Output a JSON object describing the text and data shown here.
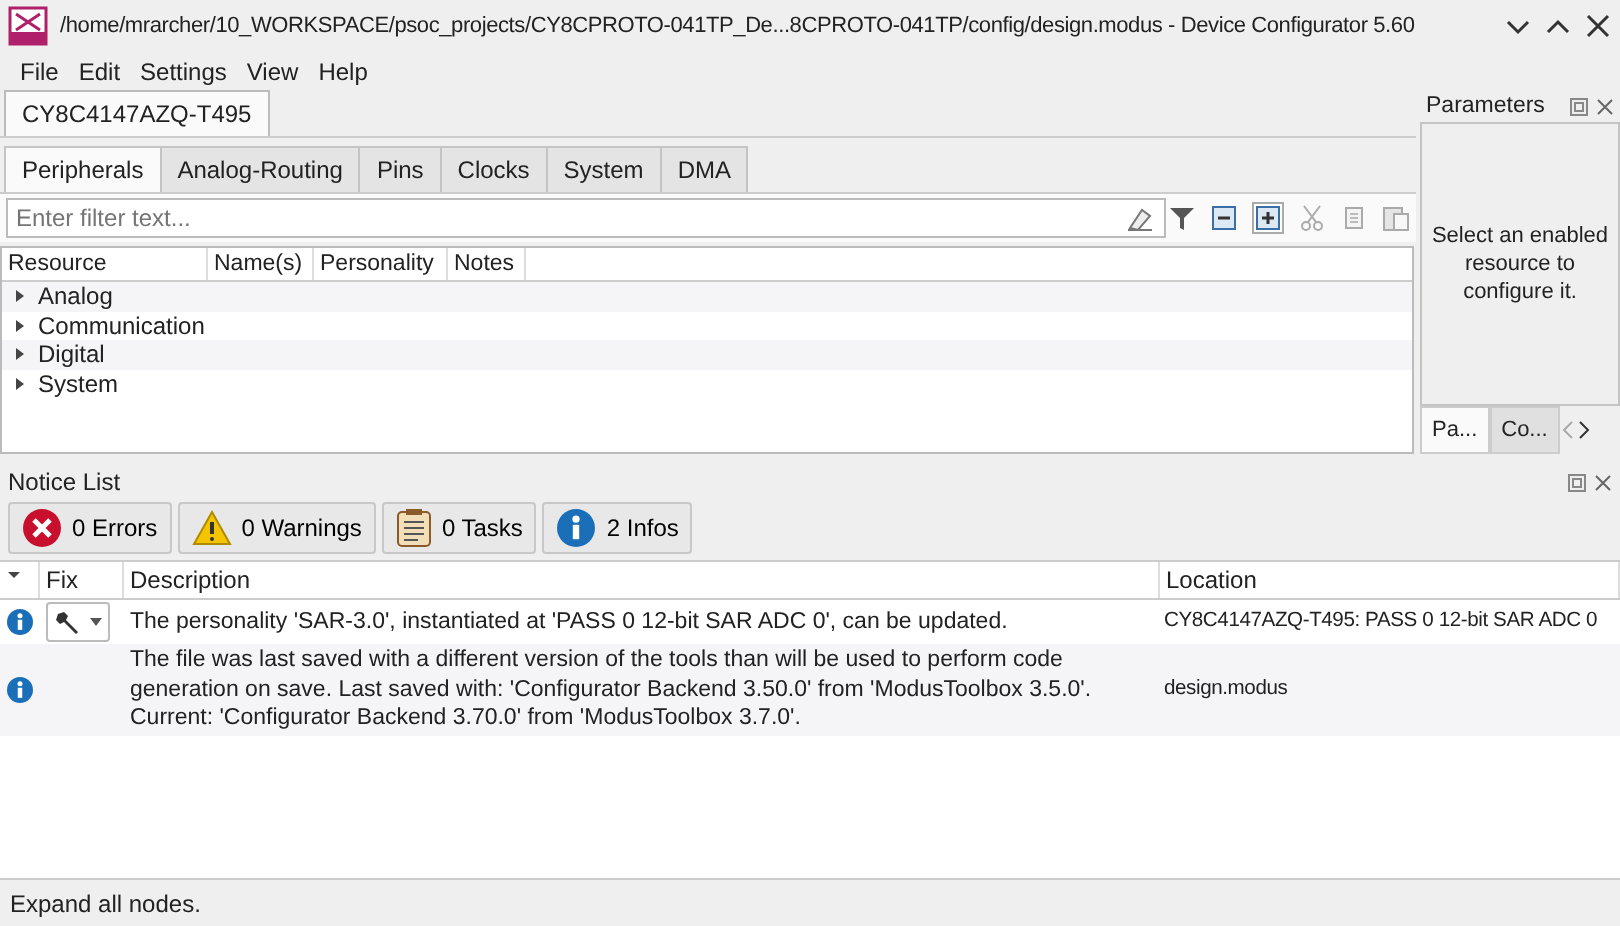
{
  "window": {
    "title": "/home/mrarcher/10_WORKSPACE/psoc_projects/CY8CPROTO-041TP_De...8CPROTO-041TP/config/design.modus - Device Configurator 5.60"
  },
  "menu": [
    "File",
    "Edit",
    "Settings",
    "View",
    "Help"
  ],
  "device_tab": "CY8C4147AZQ-T495",
  "tabs": [
    {
      "label": "Peripherals",
      "selected": true
    },
    {
      "label": "Analog-Routing",
      "selected": false
    },
    {
      "label": "Pins",
      "selected": false
    },
    {
      "label": "Clocks",
      "selected": false
    },
    {
      "label": "System",
      "selected": false
    },
    {
      "label": "DMA",
      "selected": false
    }
  ],
  "filter": {
    "placeholder": "Enter filter text..."
  },
  "tree": {
    "columns": [
      "Resource",
      "Name(s)",
      "Personality",
      "Notes"
    ],
    "items": [
      {
        "label": "Analog",
        "expanded": false
      },
      {
        "label": "Communication",
        "expanded": false
      },
      {
        "label": "Digital",
        "expanded": false
      },
      {
        "label": "System",
        "expanded": false
      }
    ]
  },
  "parameters": {
    "title": "Parameters",
    "message": "Select an enabled resource to configure it.",
    "tabs": [
      {
        "label": "Pa...",
        "selected": true
      },
      {
        "label": "Co...",
        "selected": false
      }
    ]
  },
  "notice_list": {
    "title": "Notice List",
    "filters": [
      {
        "kind": "error",
        "label": "0 Errors"
      },
      {
        "kind": "warning",
        "label": "0 Warnings"
      },
      {
        "kind": "task",
        "label": "0 Tasks"
      },
      {
        "kind": "info",
        "label": "2 Infos"
      }
    ],
    "columns": [
      "Fix",
      "Description",
      "Location"
    ],
    "rows": [
      {
        "kind": "info",
        "fix": true,
        "description": "The personality 'SAR-3.0', instantiated at 'PASS 0 12-bit SAR ADC 0', can be updated.",
        "location": "CY8C4147AZQ-T495: PASS 0 12-bit SAR ADC 0"
      },
      {
        "kind": "info",
        "fix": false,
        "description": "The file was last saved with a different version of the tools than will be used to perform code generation on save. Last saved with: 'Configurator Backend 3.50.0' from 'ModusToolbox 3.5.0'. Current: 'Configurator Backend 3.70.0' from 'ModusToolbox 3.7.0'.",
        "location": "design.modus"
      }
    ]
  },
  "status_bar": "Expand all nodes."
}
